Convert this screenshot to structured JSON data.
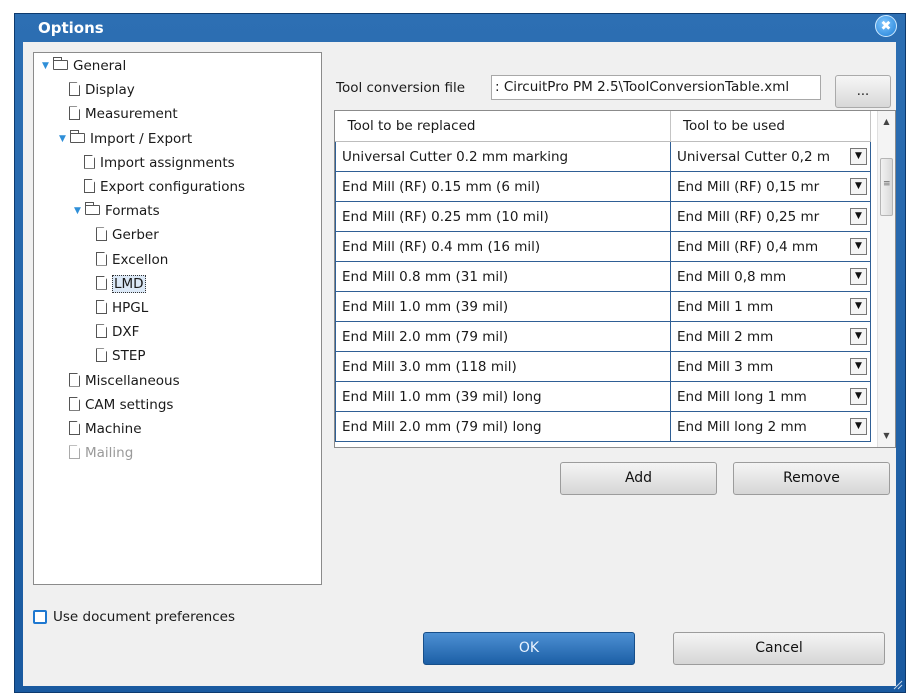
{
  "window": {
    "title": "Options",
    "close_glyph": "✖"
  },
  "tree": [
    {
      "label": "General",
      "type": "folder",
      "level": 0,
      "expanded": true
    },
    {
      "label": "Display",
      "type": "doc",
      "level": 1
    },
    {
      "label": "Measurement",
      "type": "doc",
      "level": 1
    },
    {
      "label": "Import / Export",
      "type": "folder",
      "level": 1,
      "expanded": true
    },
    {
      "label": "Import assignments",
      "type": "doc",
      "level": 2
    },
    {
      "label": "Export configurations",
      "type": "doc",
      "level": 2
    },
    {
      "label": "Formats",
      "type": "folder",
      "level": 2,
      "expanded": true
    },
    {
      "label": "Gerber",
      "type": "doc",
      "level": 3
    },
    {
      "label": "Excellon",
      "type": "doc",
      "level": 3
    },
    {
      "label": "LMD",
      "type": "doc",
      "level": 3,
      "selected": true
    },
    {
      "label": "HPGL",
      "type": "doc",
      "level": 3
    },
    {
      "label": "DXF",
      "type": "doc",
      "level": 3
    },
    {
      "label": "STEP",
      "type": "doc",
      "level": 3
    },
    {
      "label": "Miscellaneous",
      "type": "doc",
      "level": 1
    },
    {
      "label": "CAM settings",
      "type": "doc",
      "level": 1
    },
    {
      "label": "Machine",
      "type": "doc",
      "level": 1
    },
    {
      "label": "Mailing",
      "type": "doc",
      "level": 1,
      "disabled": true
    }
  ],
  "use_doc_prefs": {
    "label": "Use document preferences",
    "checked": false
  },
  "tool_conversion": {
    "label": "Tool conversion file",
    "value": ": CircuitPro PM 2.5\\ToolConversionTable.xml",
    "browse_label": "..."
  },
  "grid": {
    "columns": [
      "Tool to be replaced",
      "Tool to be used"
    ],
    "rows": [
      [
        "Universal Cutter 0.2 mm marking",
        "Universal Cutter 0,2 m"
      ],
      [
        "End Mill (RF) 0.15 mm (6 mil)",
        "End Mill (RF) 0,15 mr"
      ],
      [
        "End Mill (RF) 0.25 mm (10 mil)",
        "End Mill (RF) 0,25 mr"
      ],
      [
        "End Mill (RF) 0.4 mm (16 mil)",
        "End Mill (RF) 0,4 mm"
      ],
      [
        "End Mill 0.8 mm (31 mil)",
        "End Mill 0,8 mm"
      ],
      [
        "End Mill 1.0 mm (39 mil)",
        "End Mill 1 mm"
      ],
      [
        "End Mill 2.0 mm (79 mil)",
        "End Mill 2 mm"
      ],
      [
        "End Mill 3.0 mm (118 mil)",
        "End Mill 3 mm"
      ],
      [
        "End Mill 1.0 mm (39 mil) long",
        "End Mill long 1 mm"
      ],
      [
        "End Mill 2.0 mm (79 mil) long",
        "End Mill long 2 mm"
      ]
    ]
  },
  "buttons": {
    "add": "Add",
    "remove": "Remove",
    "ok": "OK",
    "cancel": "Cancel"
  },
  "colors": {
    "title_bar": "#1a5aa0",
    "grid_border": "#2f5f95",
    "checkbox": "#1e78d0"
  }
}
